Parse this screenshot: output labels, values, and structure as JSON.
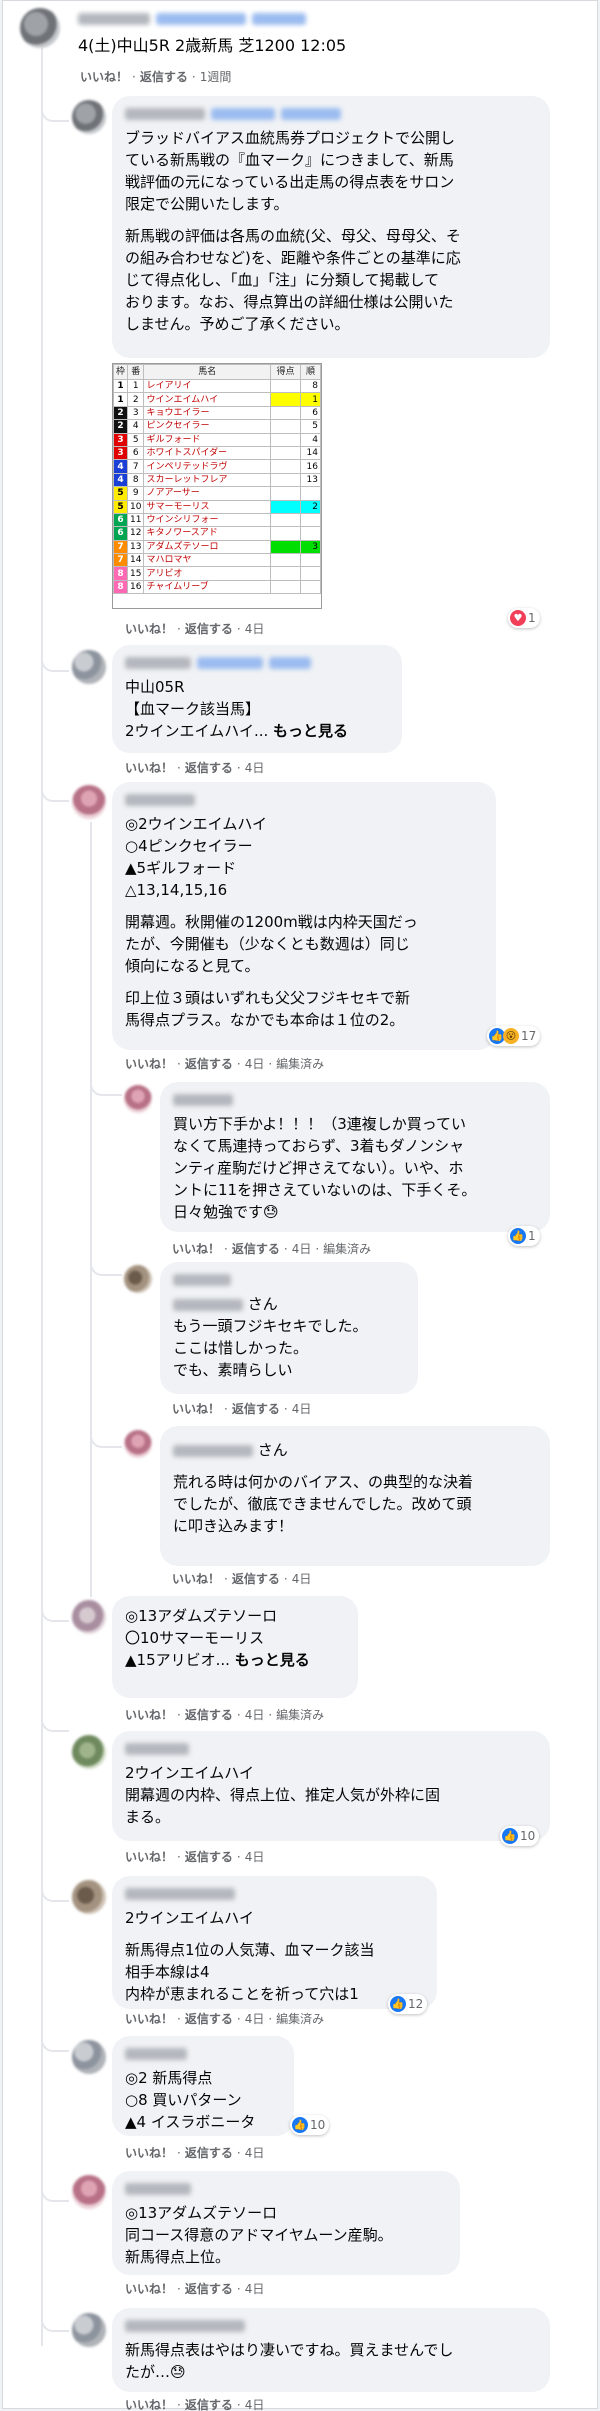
{
  "colors": {
    "highlight_yellow": "#ffff00",
    "highlight_cyan": "#00ffff",
    "highlight_green": "#00dd00",
    "link": "#1877f2"
  },
  "post": {
    "race_line": "4(土)中山5R 2歳新馬 芝1200 12:05",
    "like_label": "いいね！",
    "reply_label": "返信する",
    "time": "1週間"
  },
  "comments": [
    {
      "lines": [
        "ブラッドバイアス血統馬券プロジェクトで公開し",
        "ている新馬戦の『血マーク』につきまして、新馬",
        "戦評価の元になっている出走馬の得点表をサロン",
        "限定で公開いたします。"
      ],
      "lines2": [
        "新馬戦の評価は各馬の血統(父、母父、母母父、そ",
        "の組み合わせなど)を、距離や条件ごとの基準に応",
        "じて得点化し、「血」「注」に分類して掲載して",
        "おります。なお、得点算出の詳細仕様は公開いた",
        "しません。予めご了承ください。"
      ],
      "time": "4日",
      "reaction_count": "1"
    },
    {
      "lines": [
        "中山05R",
        "【血マーク該当馬】",
        "2ウインエイムハイ..."
      ],
      "more": "もっと見る",
      "time": "4日"
    },
    {
      "lines": [
        "◎2ウインエイムハイ",
        "○4ピンクセイラー",
        "▲5ギルフォード",
        "△13,14,15,16"
      ],
      "lines2": [
        "開幕週。秋開催の1200m戦は内枠天国だっ",
        "たが、今開催も（少なくとも数週は）同じ",
        "傾向になると見て。"
      ],
      "lines3": [
        "印上位３頭はいずれも父父フジキセキで新",
        "馬得点プラス。なかでも本命は１位の2。"
      ],
      "time": "4日",
      "edited": "編集済み",
      "reaction_count": "17"
    },
    {
      "lines": [
        "買い方下手かよ！！！（3連複しか買ってい",
        "なくて馬連持っておらず、3着もダノンシャ",
        "ンティ産駒だけど押さえてない）。いや、ホ",
        "ントに11を押さえていないのは、下手くそ。",
        "日々勉強です😓"
      ],
      "time": "4日",
      "edited": "編集済み",
      "reaction_count": "1"
    },
    {
      "name_suffix": "さん",
      "lines": [
        "もう一頭フジキセキでした。",
        "ここは惜しかった。",
        "でも、素晴らしい"
      ],
      "time": "4日"
    },
    {
      "name_suffix": "さん",
      "lines": [
        "荒れる時は何かのバイアス、の典型的な決着",
        "でしたが、徹底できませんでした。改めて頭",
        "に叩き込みます！"
      ],
      "time": "4日"
    },
    {
      "lines": [
        "◎13アダムズテソーロ",
        "〇10サマーモーリス",
        "▲15アリビオ..."
      ],
      "more": "もっと見る",
      "time": "4日",
      "edited": "編集済み"
    },
    {
      "lines": [
        "2ウインエイムハイ",
        "開幕週の内枠、得点上位、推定人気が外枠に固",
        "まる。"
      ],
      "time": "4日",
      "reaction_count": "10"
    },
    {
      "lines": [
        "2ウインエイムハイ"
      ],
      "lines2": [
        "新馬得点1位の人気薄、血マーク該当",
        "相手本線は4",
        "内枠が恵まれることを祈って穴は1"
      ],
      "time": "4日",
      "edited": "編集済み",
      "reaction_count": "12"
    },
    {
      "lines": [
        "◎2 新馬得点",
        "○8 買いパターン",
        "▲4 イスラボニータ"
      ],
      "time": "4日",
      "reaction_count": "10"
    },
    {
      "lines": [
        "◎13アダムズテソーロ",
        "同コース得意のアドマイヤムーン産駒。",
        "新馬得点上位。"
      ],
      "time": "4日"
    },
    {
      "lines": [
        "新馬得点表はやはり凄いですね。買えませんでし",
        "たが…😓"
      ],
      "time": "4日"
    }
  ],
  "table": {
    "headers": [
      "枠",
      "番",
      "馬名",
      "得点",
      "順"
    ],
    "rows": [
      {
        "waku": "1",
        "num": "1",
        "horse": "レイアリイ",
        "rank": "8",
        "waku_color": "#ffffff",
        "hl": ""
      },
      {
        "waku": "1",
        "num": "2",
        "horse": "ウインエイムハイ",
        "rank": "1",
        "waku_color": "#ffffff",
        "hl": "#ffff00"
      },
      {
        "waku": "2",
        "num": "3",
        "horse": "キョウエイラー",
        "rank": "6",
        "waku_color": "#111111",
        "hl": ""
      },
      {
        "waku": "2",
        "num": "4",
        "horse": "ピンクセイラー",
        "rank": "5",
        "waku_color": "#111111",
        "hl": ""
      },
      {
        "waku": "3",
        "num": "5",
        "horse": "ギルフォード",
        "rank": "4",
        "waku_color": "#e00000",
        "hl": ""
      },
      {
        "waku": "3",
        "num": "6",
        "horse": "ホワイトスパイダー",
        "rank": "14",
        "waku_color": "#e00000",
        "hl": ""
      },
      {
        "waku": "4",
        "num": "7",
        "horse": "インペリテッドラヴ",
        "rank": "16",
        "waku_color": "#1a3fd6",
        "hl": ""
      },
      {
        "waku": "4",
        "num": "8",
        "horse": "スカーレットフレア",
        "rank": "13",
        "waku_color": "#1a3fd6",
        "hl": ""
      },
      {
        "waku": "5",
        "num": "9",
        "horse": "ノアアーサー",
        "rank": "",
        "waku_color": "#ffeb00",
        "hl": ""
      },
      {
        "waku": "5",
        "num": "10",
        "horse": "サマーモーリス",
        "rank": "2",
        "waku_color": "#ffeb00",
        "hl": "#00ffff"
      },
      {
        "waku": "6",
        "num": "11",
        "horse": "ウインシリフォー",
        "rank": "",
        "waku_color": "#00a651",
        "hl": ""
      },
      {
        "waku": "6",
        "num": "12",
        "horse": "キタノワースアド",
        "rank": "",
        "waku_color": "#00a651",
        "hl": ""
      },
      {
        "waku": "7",
        "num": "13",
        "horse": "アダムズテソーロ",
        "rank": "3",
        "waku_color": "#ff8c00",
        "hl": "#00dd00"
      },
      {
        "waku": "7",
        "num": "14",
        "horse": "マハロマヤ",
        "rank": "",
        "waku_color": "#ff8c00",
        "hl": ""
      },
      {
        "waku": "8",
        "num": "15",
        "horse": "アリビオ",
        "rank": "",
        "waku_color": "#ff69b4",
        "hl": ""
      },
      {
        "waku": "8",
        "num": "16",
        "horse": "チャイムリーブ",
        "rank": "",
        "waku_color": "#ff69b4",
        "hl": ""
      }
    ]
  }
}
